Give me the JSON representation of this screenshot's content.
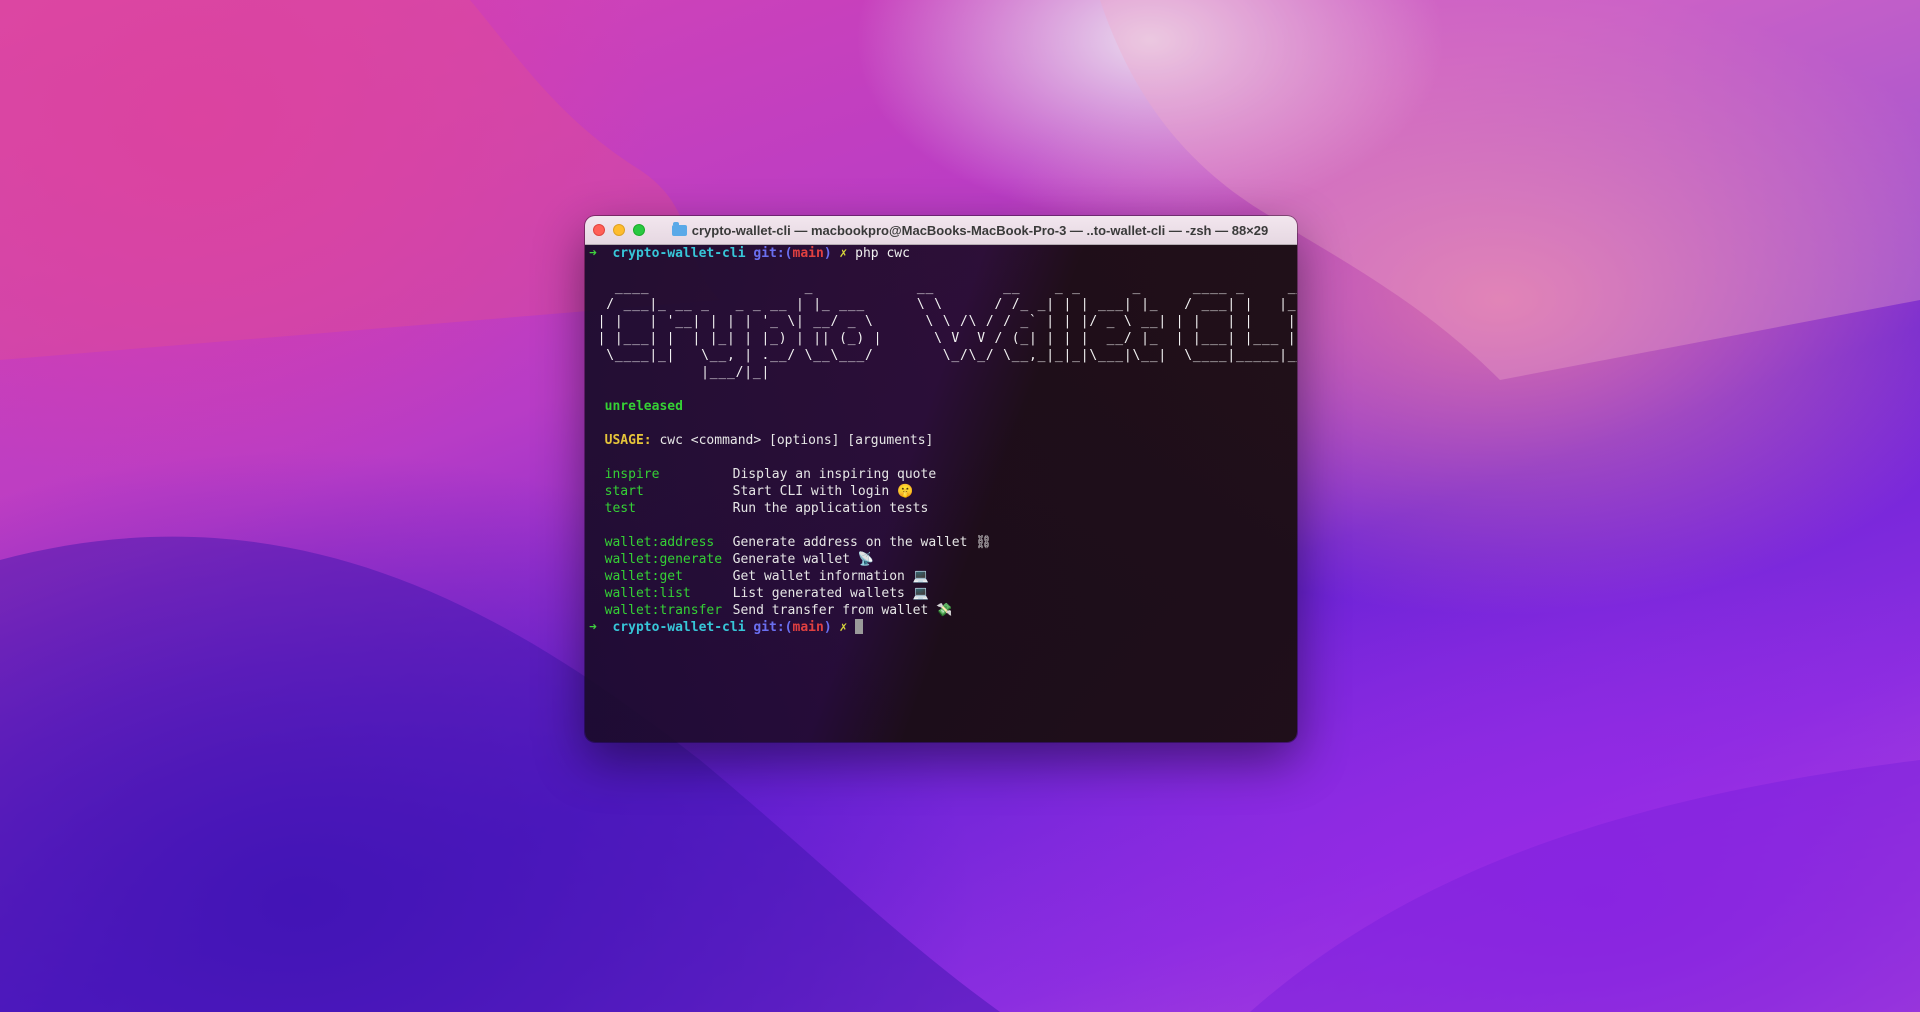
{
  "window": {
    "title": "crypto-wallet-cli — macbookpro@MacBooks-MacBook-Pro-3 — ..to-wallet-cli — -zsh — 88×29"
  },
  "prompt": {
    "arrow": "➜",
    "dir": "crypto-wallet-cli",
    "git_label": "git:(",
    "branch": "main",
    "git_close": ")",
    "dirty": "✗",
    "command": "php cwc"
  },
  "banner_ascii": "   ____                  _            __        __    _ _      _      ____ _     ___ \n  / ___|_ __ _   _ _ __ | |_ ___      \\ \\      / /_ _| | | ___| |_   / ___| |   |_ _|\n | |   | '__| | | | '_ \\| __/ _ \\      \\ \\ /\\ / / _` | | |/ _ \\ __| | |   | |    | | \n | |___| |  | |_| | |_) | || (_) |      \\ V  V / (_| | | |  __/ |_  | |___| |___ | | \n  \\____|_|   \\__, | .__/ \\__\\___/        \\_/\\_/ \\__,_|_|_|\\___|\\__|  \\____|_____|___|\n             |___/|_|",
  "version": "unreleased",
  "usage": {
    "label": "USAGE:",
    "text": "cwc <command> [options] [arguments]"
  },
  "commands": [
    {
      "name": "inspire",
      "desc": "Display an inspiring quote"
    },
    {
      "name": "start",
      "desc": "Start CLI with login 🤫"
    },
    {
      "name": "test",
      "desc": "Run the application tests"
    }
  ],
  "wallet_commands": [
    {
      "name": "wallet:address",
      "desc": "Generate address on the wallet ⛓"
    },
    {
      "name": "wallet:generate",
      "desc": "Generate wallet 📡"
    },
    {
      "name": "wallet:get",
      "desc": "Get wallet information 💻"
    },
    {
      "name": "wallet:list",
      "desc": "List generated wallets 💻"
    },
    {
      "name": "wallet:transfer",
      "desc": "Send transfer from wallet 💸"
    }
  ],
  "colors": {
    "prompt_arrow": "#3fd13f",
    "dir": "#37c6d8",
    "git": "#6a6ff0",
    "branch": "#e04040",
    "command_name": "#35d135",
    "usage_label": "#e6c43a"
  }
}
